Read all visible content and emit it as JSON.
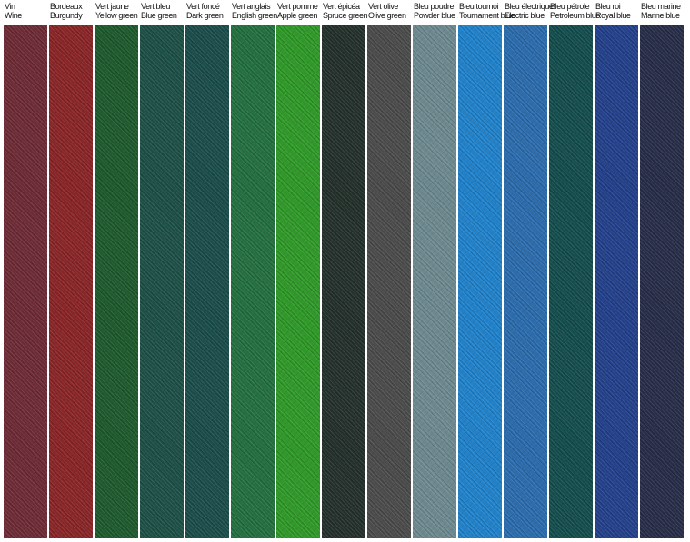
{
  "swatches": [
    {
      "fr": "Vin",
      "en": "Wine",
      "color": "#6e2a35"
    },
    {
      "fr": "Bordeaux",
      "en": "Burgundy",
      "color": "#8a2426"
    },
    {
      "fr": "Vert jaune",
      "en": "Yellow green",
      "color": "#1d5a2c"
    },
    {
      "fr": "Vert bleu",
      "en": "Blue green",
      "color": "#1c5046"
    },
    {
      "fr": "Vert foncé",
      "en": "Dark green",
      "color": "#1a4d4a"
    },
    {
      "fr": "Vert anglais",
      "en": "English green",
      "color": "#22703f"
    },
    {
      "fr": "Vert pomme",
      "en": "Apple green",
      "color": "#2e9a27"
    },
    {
      "fr": "Vert épicéa",
      "en": "Spruce green",
      "color": "#23302a"
    },
    {
      "fr": "Vert olive",
      "en": "Olive green",
      "color": "#4a4b4a"
    },
    {
      "fr": "Bleu poudre",
      "en": "Powder blue",
      "color": "#6d8a90"
    },
    {
      "fr": "Bleu tournoi",
      "en": "Tournament blue",
      "color": "#1f82cc"
    },
    {
      "fr": "Bleu électrique",
      "en": "Electric blue",
      "color": "#2a6cae"
    },
    {
      "fr": "Bleu pétrole",
      "en": "Petroleum blue",
      "color": "#134d4d"
    },
    {
      "fr": "Bleu roi",
      "en": "Royal blue",
      "color": "#22408c"
    },
    {
      "fr": "Bleu marine",
      "en": "Marine blue",
      "color": "#272d48"
    }
  ]
}
